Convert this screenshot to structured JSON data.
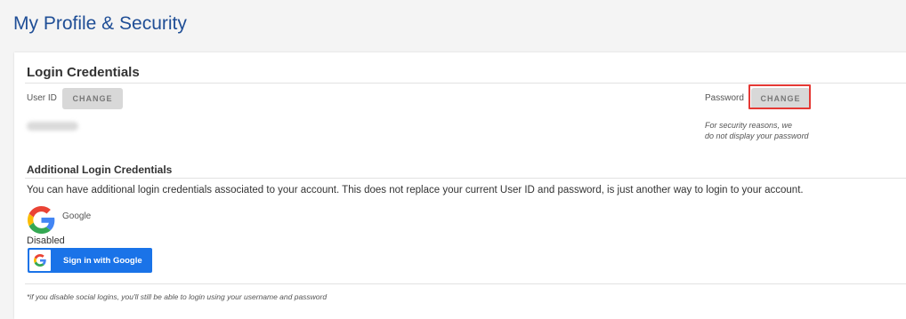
{
  "page": {
    "title": "My Profile & Security"
  },
  "login_credentials": {
    "title": "Login Credentials",
    "user_id": {
      "label": "User ID",
      "button": "CHANGE"
    },
    "password": {
      "label": "Password",
      "button": "CHANGE",
      "note_line1": "For security reasons, we",
      "note_line2": "do not display your password"
    }
  },
  "additional": {
    "title": "Additional Login Credentials",
    "description": "You can have additional login credentials associated to your account. This does not replace your current User ID and password, is just another way to login to your account.",
    "provider": {
      "name": "Google",
      "icon": "google-logo-icon",
      "status": "Disabled",
      "signin_button": "Sign in with Google"
    },
    "footnote": "*if you disable social logins, you'll still be able to login using your username and password"
  },
  "colors": {
    "title": "#1f4e96",
    "google_blue": "#1a73e8",
    "highlight": "#e53935",
    "button_bg": "#d8d8d8"
  }
}
